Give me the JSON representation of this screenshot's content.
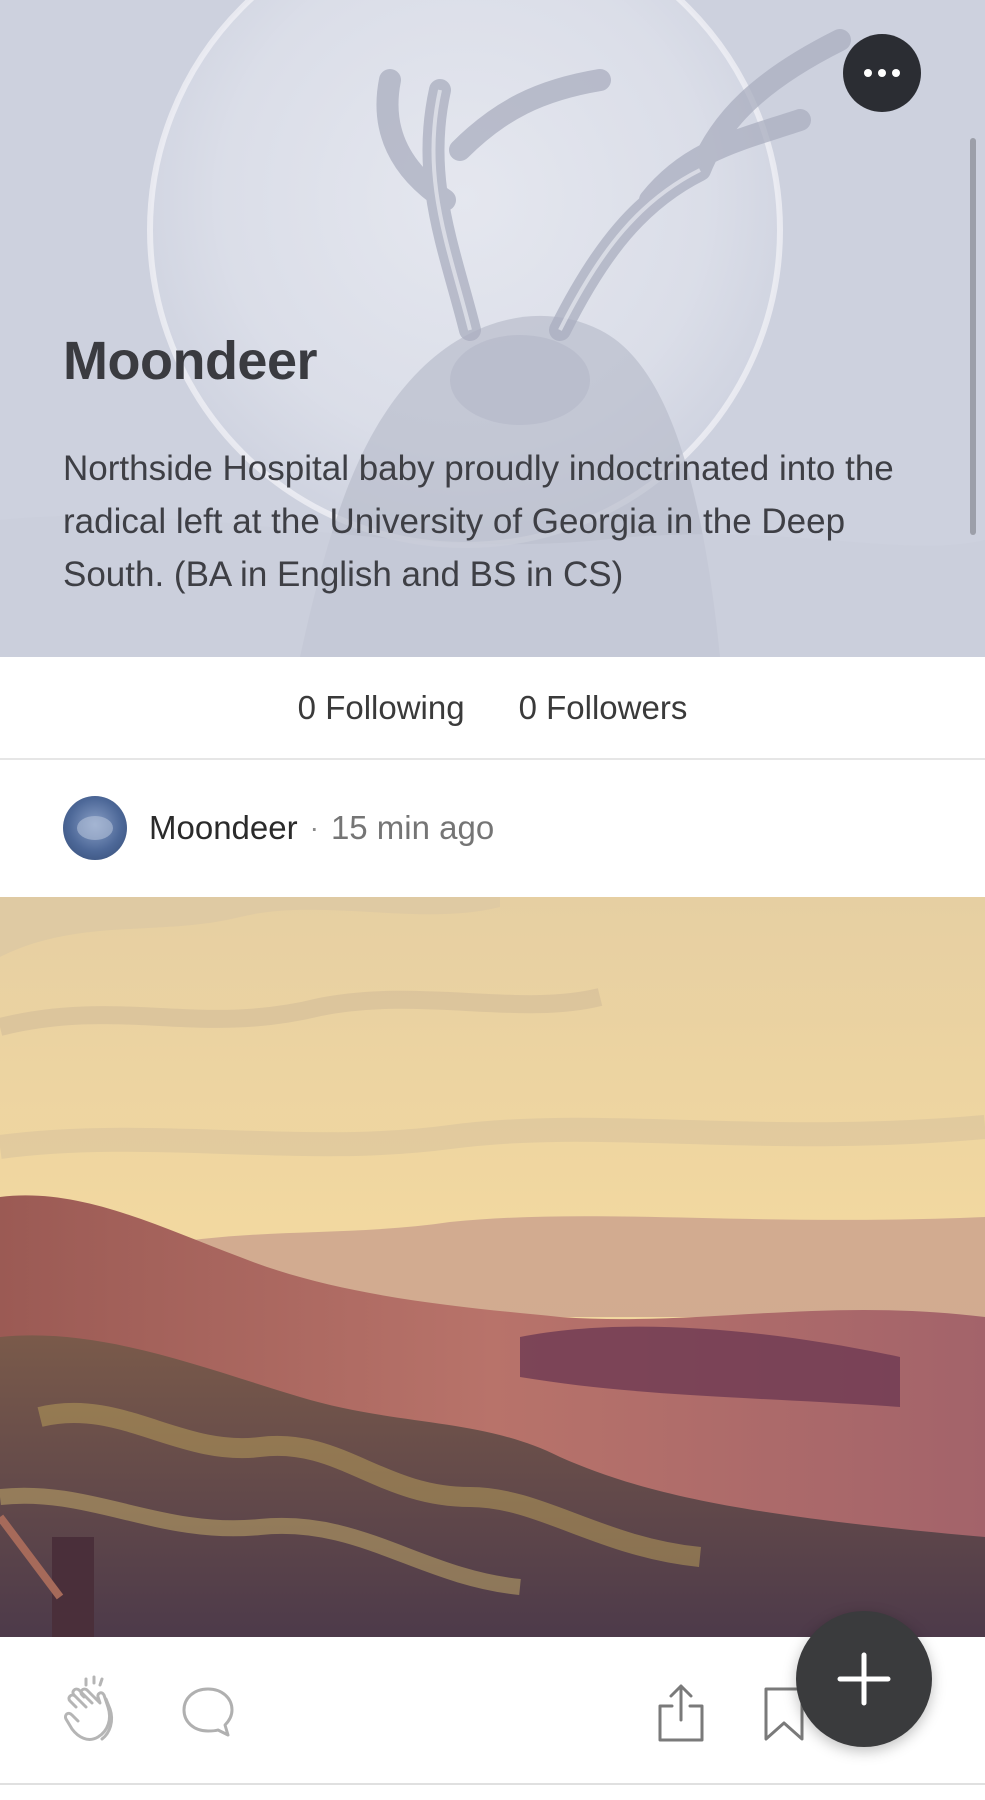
{
  "profile": {
    "name": "Moondeer",
    "bio": "Northside Hospital baby proudly indoctrinated into the radical left at the University of Georgia in the Deep South. (BA in English and BS in CS)",
    "following_label": "0 Following",
    "followers_label": "0 Followers"
  },
  "header": {
    "more_icon": "more-horizontal-icon",
    "background_color": "#cfd3e0"
  },
  "post": {
    "author": "Moondeer",
    "separator": "·",
    "time": "15 min ago",
    "image_description_icon": "landscape-image"
  },
  "actions": {
    "clap_icon": "clap-icon",
    "comment_icon": "comment-icon",
    "share_icon": "share-icon",
    "bookmark_icon": "bookmark-icon",
    "compose_icon": "plus-icon"
  },
  "colors": {
    "fab": "#3a3b3d",
    "text_primary": "#242424",
    "text_secondary": "#757575"
  }
}
